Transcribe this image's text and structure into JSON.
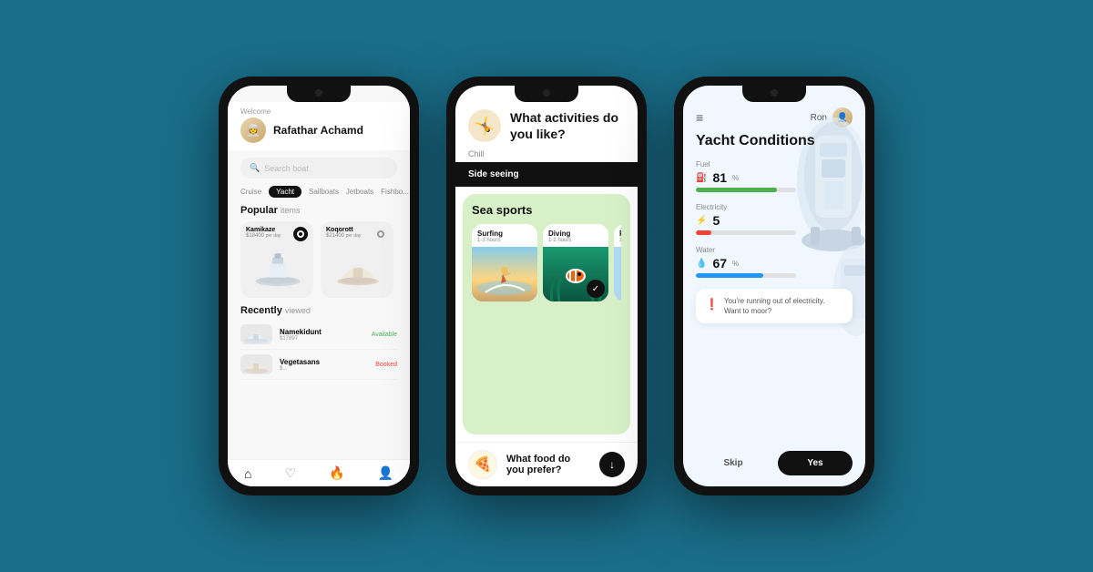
{
  "background": "#1a6e8a",
  "phone1": {
    "welcome_label": "Welcome",
    "username": "Rafathar Achamd",
    "search_placeholder": "Search boat",
    "tabs": [
      "Cruise",
      "Yacht",
      "Sailboats",
      "Jetboats",
      "Fishbo..."
    ],
    "active_tab": "Yacht",
    "popular_label": "Popular",
    "popular_sub": "items",
    "boats": [
      {
        "name": "Kamikaze",
        "price": "$18400",
        "price_sub": "per day"
      },
      {
        "name": "Koqorott",
        "price": "$21400",
        "price_sub": "per day"
      }
    ],
    "recently_label": "Recently",
    "recently_sub": "viewed",
    "recent_items": [
      {
        "name": "Namekidunt",
        "price": "$17897",
        "status": "Available"
      },
      {
        "name": "Vegetasans",
        "price": "...",
        "status": "Booked"
      }
    ],
    "nav": [
      "Home",
      "Favorites",
      "Trending",
      "Profile"
    ]
  },
  "phone2": {
    "question": "What activities do you like?",
    "chill_label": "Chill",
    "side_seeing_label": "Side seeing",
    "sea_sports_label": "Sea sports",
    "activities": [
      {
        "name": "Surfing",
        "time": "1-3 hours"
      },
      {
        "name": "Diving",
        "time": "1-2 hours"
      },
      {
        "name": "P...",
        "time": "1-..."
      }
    ],
    "food_question": "What food do you prefer?"
  },
  "phone3": {
    "username": "Ron",
    "title": "Yacht Conditions",
    "conditions": [
      {
        "label": "Fuel",
        "value": "81",
        "unit": "%",
        "fill": 81,
        "icon": "⛽",
        "color": "green"
      },
      {
        "label": "Electricity",
        "value": "5",
        "unit": "",
        "fill": 15,
        "icon": "⚡",
        "color": "red"
      },
      {
        "label": "Water",
        "value": "67",
        "unit": "%",
        "fill": 67,
        "icon": "💧",
        "color": "blue"
      }
    ],
    "warning_text": "You're running out of electricity. Want to moor?",
    "skip_label": "Skip",
    "yes_label": "Yes"
  }
}
